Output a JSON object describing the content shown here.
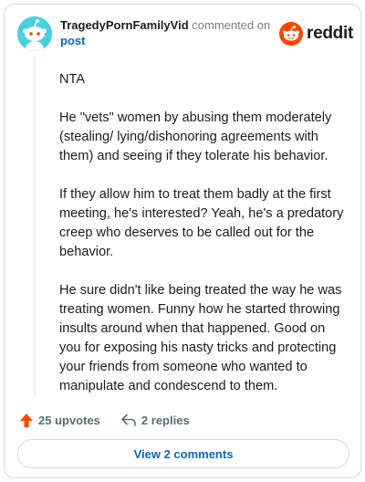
{
  "colors": {
    "upvote": "#ff4500",
    "link": "#0a66c2",
    "avatar_bg": "#49cfe0",
    "muted": "#576f76"
  },
  "comment": {
    "username": "TragedyPornFamilyVid",
    "action_text": "commented on",
    "post_link": "post",
    "brand": "reddit",
    "icons": {
      "avatar": "snoo-avatar-icon",
      "brand": "reddit-logo-icon"
    },
    "paragraphs": [
      "NTA",
      "He \"vets\" women by abusing them moderately (stealing/ lying/dishonoring agreements with them) and seeing if they tolerate his behavior.",
      "If they allow him to treat them badly at the first meeting, he's interested? Yeah, he's a predatory creep who deserves to be called out for the behavior.",
      "He sure didn't like being treated the way he was treating women. Funny how he started throwing insults around when that happened. Good on you for exposing his nasty tricks and protecting your friends from someone who wanted to manipulate and condescend to them."
    ]
  },
  "footer": {
    "upvotes": "25 upvotes",
    "replies": "2 replies",
    "icons": {
      "upvote": "upvote-arrow-icon",
      "reply": "reply-arrow-icon"
    }
  },
  "view_comments_label": "View 2 comments"
}
